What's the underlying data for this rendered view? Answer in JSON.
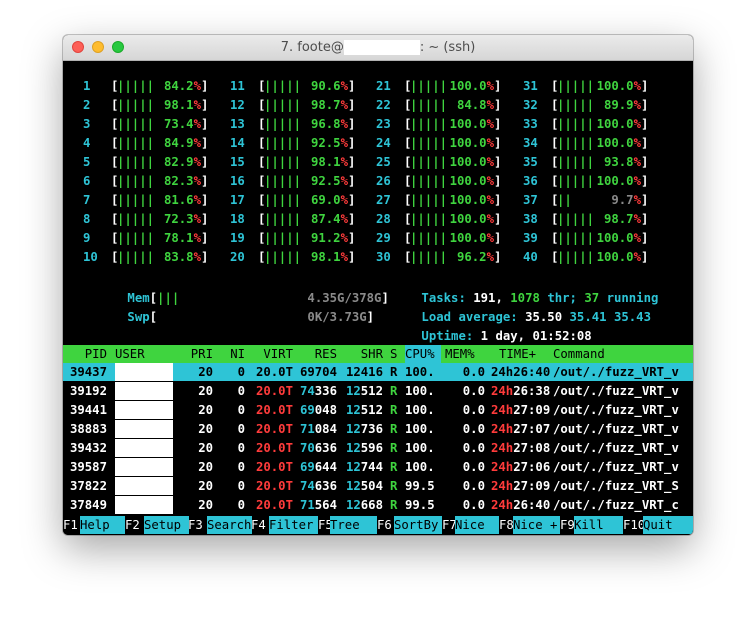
{
  "window": {
    "title_prefix": "7. foote@",
    "title_suffix": ": ~ (ssh)"
  },
  "colors": {
    "green": "#3fd43f",
    "red": "#ff3b3b",
    "cyan": "#2ec4d6",
    "white": "#ffffff",
    "grey": "#8a8a8a"
  },
  "cpus": [
    {
      "num": "1",
      "bars": "||||||",
      "value": "84.2",
      "col": 0,
      "row": 0,
      "bars_fill": "green"
    },
    {
      "num": "2",
      "bars": "||||||",
      "value": "98.1",
      "col": 0,
      "row": 1
    },
    {
      "num": "3",
      "bars": "||||||",
      "value": "73.4",
      "col": 0,
      "row": 2
    },
    {
      "num": "4",
      "bars": "||||||",
      "value": "84.9",
      "col": 0,
      "row": 3
    },
    {
      "num": "5",
      "bars": "||||||",
      "value": "82.9",
      "col": 0,
      "row": 4
    },
    {
      "num": "6",
      "bars": "||||||",
      "value": "82.3",
      "col": 0,
      "row": 5
    },
    {
      "num": "7",
      "bars": "||||||",
      "value": "81.6",
      "col": 0,
      "row": 6
    },
    {
      "num": "8",
      "bars": "||||||",
      "value": "72.3",
      "col": 0,
      "row": 7
    },
    {
      "num": "9",
      "bars": "||||||",
      "value": "78.1",
      "col": 0,
      "row": 8
    },
    {
      "num": "10",
      "bars": "||||||",
      "value": "83.8",
      "col": 0,
      "row": 9
    },
    {
      "num": "11",
      "bars": "||||||",
      "value": "90.6",
      "col": 1,
      "row": 0
    },
    {
      "num": "12",
      "bars": "||||||",
      "value": "98.7",
      "col": 1,
      "row": 1
    },
    {
      "num": "13",
      "bars": "||||||",
      "value": "96.8",
      "col": 1,
      "row": 2
    },
    {
      "num": "14",
      "bars": "||||||",
      "value": "92.5",
      "col": 1,
      "row": 3
    },
    {
      "num": "15",
      "bars": "||||||",
      "value": "98.1",
      "col": 1,
      "row": 4
    },
    {
      "num": "16",
      "bars": "||||||",
      "value": "92.5",
      "col": 1,
      "row": 5
    },
    {
      "num": "17",
      "bars": "||||||",
      "value": "69.0",
      "col": 1,
      "row": 6
    },
    {
      "num": "18",
      "bars": "||||||",
      "value": "87.4",
      "col": 1,
      "row": 7
    },
    {
      "num": "19",
      "bars": "||||||",
      "value": "91.2",
      "col": 1,
      "row": 8
    },
    {
      "num": "20",
      "bars": "||||||",
      "value": "98.1",
      "col": 1,
      "row": 9
    },
    {
      "num": "21",
      "bars": "|||||",
      "value": "100.0",
      "col": 2,
      "row": 0
    },
    {
      "num": "22",
      "bars": "||||||",
      "value": "84.8",
      "col": 2,
      "row": 1
    },
    {
      "num": "23",
      "bars": "|||||",
      "value": "100.0",
      "col": 2,
      "row": 2
    },
    {
      "num": "24",
      "bars": "|||||",
      "value": "100.0",
      "col": 2,
      "row": 3
    },
    {
      "num": "25",
      "bars": "|||||",
      "value": "100.0",
      "col": 2,
      "row": 4
    },
    {
      "num": "26",
      "bars": "|||||",
      "value": "100.0",
      "col": 2,
      "row": 5
    },
    {
      "num": "27",
      "bars": "|||||",
      "value": "100.0",
      "col": 2,
      "row": 6
    },
    {
      "num": "28",
      "bars": "|||||",
      "value": "100.0",
      "col": 2,
      "row": 7
    },
    {
      "num": "29",
      "bars": "|||||",
      "value": "100.0",
      "col": 2,
      "row": 8
    },
    {
      "num": "30",
      "bars": "||||||",
      "value": "96.2",
      "col": 2,
      "row": 9
    },
    {
      "num": "31",
      "bars": "|||||",
      "value": "100.0",
      "col": 3,
      "row": 0
    },
    {
      "num": "32",
      "bars": "||||||",
      "value": "89.9",
      "col": 3,
      "row": 1
    },
    {
      "num": "33",
      "bars": "|||||",
      "value": "100.0",
      "col": 3,
      "row": 2
    },
    {
      "num": "34",
      "bars": "|||||",
      "value": "100.0",
      "col": 3,
      "row": 3
    },
    {
      "num": "35",
      "bars": "||||||",
      "value": "93.8",
      "col": 3,
      "row": 4
    },
    {
      "num": "36",
      "bars": "|||||",
      "value": "100.0",
      "col": 3,
      "row": 5
    },
    {
      "num": "37",
      "bars": "||",
      "value": "9.7",
      "col": 3,
      "row": 6
    },
    {
      "num": "38",
      "bars": "||||||",
      "value": "98.7",
      "col": 3,
      "row": 7
    },
    {
      "num": "39",
      "bars": "|||||",
      "value": "100.0",
      "col": 3,
      "row": 8
    },
    {
      "num": "40",
      "bars": "|||||",
      "value": "100.0",
      "col": 3,
      "row": 9
    }
  ],
  "mem": {
    "label": "Mem",
    "bars": "|||",
    "value": "4.35G/378G"
  },
  "swp": {
    "label": "Swp",
    "value": "0K/3.73G"
  },
  "tasks": {
    "label": "Tasks:",
    "count": "191,",
    "thr": "1078",
    "thr_label": "thr;",
    "running": "37",
    "running_label": "running"
  },
  "load": {
    "label": "Load average:",
    "v1": "35.50",
    "v2": "35.41",
    "v3": "35.43"
  },
  "uptime": {
    "label": "Uptime:",
    "value": "1 day, 01:52:08"
  },
  "headers": {
    "pid": "PID",
    "user": "USER",
    "pri": "PRI",
    "ni": "NI",
    "virt": "VIRT",
    "res": "RES",
    "shr": "SHR",
    "s": "S",
    "cpu": "CPU%",
    "mem": "MEM%",
    "time": "TIME+",
    "cmd": "Command"
  },
  "processes": [
    {
      "pid": "39437",
      "pri": "20",
      "ni": "0",
      "virt": "20.0T",
      "res": "69704",
      "shr": "12416",
      "s": "R",
      "cpu": "100.",
      "mem": "0.0",
      "time": "24h26:40",
      "cmd": "/out/./fuzz_VRT_v",
      "selected": true
    },
    {
      "pid": "39192",
      "pri": "20",
      "ni": "0",
      "virt": "20.0T",
      "res": "74336",
      "shr": "12512",
      "s": "R",
      "cpu": "100.",
      "mem": "0.0",
      "time": "24h26:38",
      "cmd": "/out/./fuzz_VRT_v"
    },
    {
      "pid": "39441",
      "pri": "20",
      "ni": "0",
      "virt": "20.0T",
      "res": "69048",
      "shr": "12512",
      "s": "R",
      "cpu": "100.",
      "mem": "0.0",
      "time": "24h27:09",
      "cmd": "/out/./fuzz_VRT_v"
    },
    {
      "pid": "38883",
      "pri": "20",
      "ni": "0",
      "virt": "20.0T",
      "res": "71084",
      "shr": "12736",
      "s": "R",
      "cpu": "100.",
      "mem": "0.0",
      "time": "24h27:07",
      "cmd": "/out/./fuzz_VRT_v"
    },
    {
      "pid": "39432",
      "pri": "20",
      "ni": "0",
      "virt": "20.0T",
      "res": "70636",
      "shr": "12596",
      "s": "R",
      "cpu": "100.",
      "mem": "0.0",
      "time": "24h27:08",
      "cmd": "/out/./fuzz_VRT_v"
    },
    {
      "pid": "39587",
      "pri": "20",
      "ni": "0",
      "virt": "20.0T",
      "res": "69644",
      "shr": "12744",
      "s": "R",
      "cpu": "100.",
      "mem": "0.0",
      "time": "24h27:06",
      "cmd": "/out/./fuzz_VRT_v"
    },
    {
      "pid": "37822",
      "pri": "20",
      "ni": "0",
      "virt": "20.0T",
      "res": "74636",
      "shr": "12504",
      "s": "R",
      "cpu": "99.5",
      "mem": "0.0",
      "time": "24h27:09",
      "cmd": "/out/./fuzz_VRT_S"
    },
    {
      "pid": "37849",
      "pri": "20",
      "ni": "0",
      "virt": "20.0T",
      "res": "71564",
      "shr": "12668",
      "s": "R",
      "cpu": "99.5",
      "mem": "0.0",
      "time": "24h26:40",
      "cmd": "/out/./fuzz_VRT_c"
    }
  ],
  "fkeys": [
    {
      "key": "F1",
      "label": "Help"
    },
    {
      "key": "F2",
      "label": "Setup"
    },
    {
      "key": "F3",
      "label": "Search"
    },
    {
      "key": "F4",
      "label": "Filter"
    },
    {
      "key": "F5",
      "label": "Tree"
    },
    {
      "key": "F6",
      "label": "SortBy"
    },
    {
      "key": "F7",
      "label": "Nice -"
    },
    {
      "key": "F8",
      "label": "Nice +"
    },
    {
      "key": "F9",
      "label": "Kill"
    },
    {
      "key": "F10",
      "label": "Quit"
    }
  ]
}
